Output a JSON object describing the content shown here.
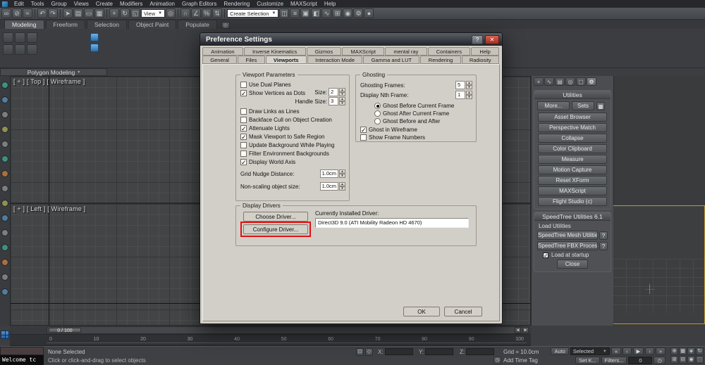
{
  "menubar": {
    "items": [
      "Edit",
      "Tools",
      "Group",
      "Views",
      "Create",
      "Modifiers",
      "Animation",
      "Graph Editors",
      "Rendering",
      "Customize",
      "MAXScript",
      "Help"
    ]
  },
  "toolbar": {
    "icons": [
      {
        "name": "select-and-link-icon",
        "glyph": "∞"
      },
      {
        "name": "unlink-selection-icon",
        "glyph": "⊘"
      },
      {
        "name": "bind-to-space-warp-icon",
        "glyph": "≈"
      },
      {
        "name": "undo-icon",
        "glyph": "↶"
      },
      {
        "name": "redo-icon",
        "glyph": "↷"
      },
      {
        "name": "select-object-icon",
        "glyph": "➤"
      },
      {
        "name": "select-by-name-icon",
        "glyph": "▤"
      },
      {
        "name": "rectangular-selection-icon",
        "glyph": "▭"
      },
      {
        "name": "window-crossing-icon",
        "glyph": "▦"
      },
      {
        "name": "select-and-move-icon",
        "glyph": "+"
      },
      {
        "name": "select-and-rotate-icon",
        "glyph": "↻"
      },
      {
        "name": "select-and-scale-icon",
        "glyph": "◱"
      },
      {
        "name": "select-and-manipulate-icon",
        "glyph": "◎"
      },
      {
        "name": "snaps-toggle-icon",
        "glyph": "∩"
      },
      {
        "name": "angle-snap-icon",
        "glyph": "∠"
      },
      {
        "name": "percent-snap-icon",
        "glyph": "%"
      },
      {
        "name": "spinner-snap-icon",
        "glyph": "⇅"
      },
      {
        "name": "mirror-icon",
        "glyph": "◫"
      },
      {
        "name": "align-icon",
        "glyph": "≡"
      },
      {
        "name": "layer-manager-icon",
        "glyph": "▣"
      },
      {
        "name": "ribbon-toggle-icon",
        "glyph": "◧"
      },
      {
        "name": "curve-editor-icon",
        "glyph": "∿"
      },
      {
        "name": "schematic-view-icon",
        "glyph": "⊞"
      },
      {
        "name": "material-editor-icon",
        "glyph": "◉"
      },
      {
        "name": "render-setup-icon",
        "glyph": "⚙"
      },
      {
        "name": "render-production-icon",
        "glyph": "●"
      }
    ],
    "coord_system_value": "View",
    "named_selection_value": "Create Selection"
  },
  "ribbon": {
    "tabs": [
      "Modeling",
      "Freeform",
      "Selection",
      "Object Paint",
      "Populate"
    ],
    "footer_label": "Polygon Modeling",
    "caret": "▾"
  },
  "viewports": {
    "top_label": "[ + ] [ Top ] [ Wireframe ]",
    "left_label": "[ + ] [ Left ] [ Wireframe ]"
  },
  "command_panel": {
    "tabs": [
      {
        "name": "create-tab-icon",
        "glyph": "+"
      },
      {
        "name": "modify-tab-icon",
        "glyph": "∿"
      },
      {
        "name": "hierarchy-tab-icon",
        "glyph": "▤"
      },
      {
        "name": "motion-tab-icon",
        "glyph": "◎"
      },
      {
        "name": "display-tab-icon",
        "glyph": "▢"
      },
      {
        "name": "utilities-tab-icon",
        "glyph": "⚙"
      }
    ],
    "utilities": {
      "header": "Utilities",
      "more_button": "More...",
      "sets_button": "Sets",
      "config_glyph": "▦",
      "buttons": [
        "Asset Browser",
        "Perspective Match",
        "Collapse",
        "Color Clipboard",
        "Measure",
        "Motion Capture",
        "Reset XForm",
        "MAXScript",
        "Flight Studio (c)"
      ]
    },
    "speedtree": {
      "header": "SpeedTree Utilities 6.1",
      "load_utilities_label": "Load Utilities",
      "mesh_button": "SpeedTree Mesh Utilities",
      "fbx_button": "SpeedTree FBX Processor",
      "help_glyph": "?",
      "startup_checkbox": {
        "label": "Load at startup",
        "checked": true
      },
      "close_button": "Close"
    }
  },
  "timeline": {
    "slider_label": "0 / 100",
    "ticks": [
      "0",
      "10",
      "20",
      "30",
      "40",
      "50",
      "60",
      "70",
      "80",
      "90",
      "100"
    ]
  },
  "statusbar": {
    "listener_text": "Welcome tc",
    "selection_status": "None Selected",
    "x_label": "X:",
    "y_label": "Y:",
    "z_label": "Z:",
    "grid_info": "Grid = 10.0cm",
    "prompt": "Click or click-and-drag to select objects",
    "add_time_tag": "Add Time Tag",
    "clock_glyph": "◷",
    "auto_button": "Auto",
    "selected_dropdown": "Selected",
    "set_key_button": "Set K...",
    "filters_button": "Filters...",
    "frame_value": "0",
    "transport": {
      "start": "«",
      "prev": "‹",
      "play": "▶",
      "next": "›",
      "end": "»"
    }
  },
  "dialog": {
    "title": "Preference Settings",
    "help_glyph": "?",
    "close_glyph": "✕",
    "annotation_color": "#e01212",
    "tabs_row1": [
      "Animation",
      "Inverse Kinematics",
      "Gizmos",
      "MAXScript",
      "mental ray",
      "Containers",
      "Help"
    ],
    "tabs_row2": [
      "General",
      "Files",
      "Viewports",
      "Interaction Mode",
      "Gamma and LUT",
      "Rendering",
      "Radiosity"
    ],
    "active_tab": "Viewports",
    "viewport_parameters": {
      "legend": "Viewport Parameters",
      "cb_dual_planes": {
        "label": "Use Dual Planes",
        "checked": false
      },
      "cb_vertices_dots": {
        "label": "Show Vertices as Dots",
        "checked": true
      },
      "size_label": "Size:",
      "size_value": "2",
      "handle_size_label": "Handle Size:",
      "handle_size_value": "3",
      "cb_draw_links": {
        "label": "Draw Links as Lines",
        "checked": false
      },
      "cb_backface": {
        "label": "Backface Cull on Object Creation",
        "checked": false
      },
      "cb_attenuate": {
        "label": "Attenuate Lights",
        "checked": true
      },
      "cb_mask_safe": {
        "label": "Mask Viewport to Safe Region",
        "checked": true
      },
      "cb_update_bg": {
        "label": "Update Background While Playing",
        "checked": false
      },
      "cb_filter_env": {
        "label": "Filter Environment Backgrounds",
        "checked": false
      },
      "cb_world_axis": {
        "label": "Display World Axis",
        "checked": true
      },
      "grid_nudge_label": "Grid Nudge Distance:",
      "grid_nudge_value": "1.0cm",
      "nonscaling_label": "Non-scaling object size:",
      "nonscaling_value": "1.0cm"
    },
    "ghosting": {
      "legend": "Ghosting",
      "frames_label": "Ghosting Frames:",
      "frames_value": "5",
      "nth_label": "Display Nth Frame:",
      "nth_value": "1",
      "radio_before": {
        "label": "Ghost Before Current Frame",
        "selected": true
      },
      "radio_after": {
        "label": "Ghost After Current Frame",
        "selected": false
      },
      "radio_both": {
        "label": "Ghost Before and After",
        "selected": false
      },
      "cb_wireframe": {
        "label": "Ghost in Wireframe",
        "checked": true
      },
      "cb_frame_numbers": {
        "label": "Show Frame Numbers",
        "checked": false
      }
    },
    "display_drivers": {
      "legend": "Display Drivers",
      "choose_button": "Choose Driver...",
      "configure_button": "Configure Driver...",
      "installed_label": "Currently Installed Driver:",
      "driver_value": "Direct3D 9.0 (ATI Mobility Radeon HD 4670)"
    },
    "ok_button": "OK",
    "cancel_button": "Cancel"
  }
}
